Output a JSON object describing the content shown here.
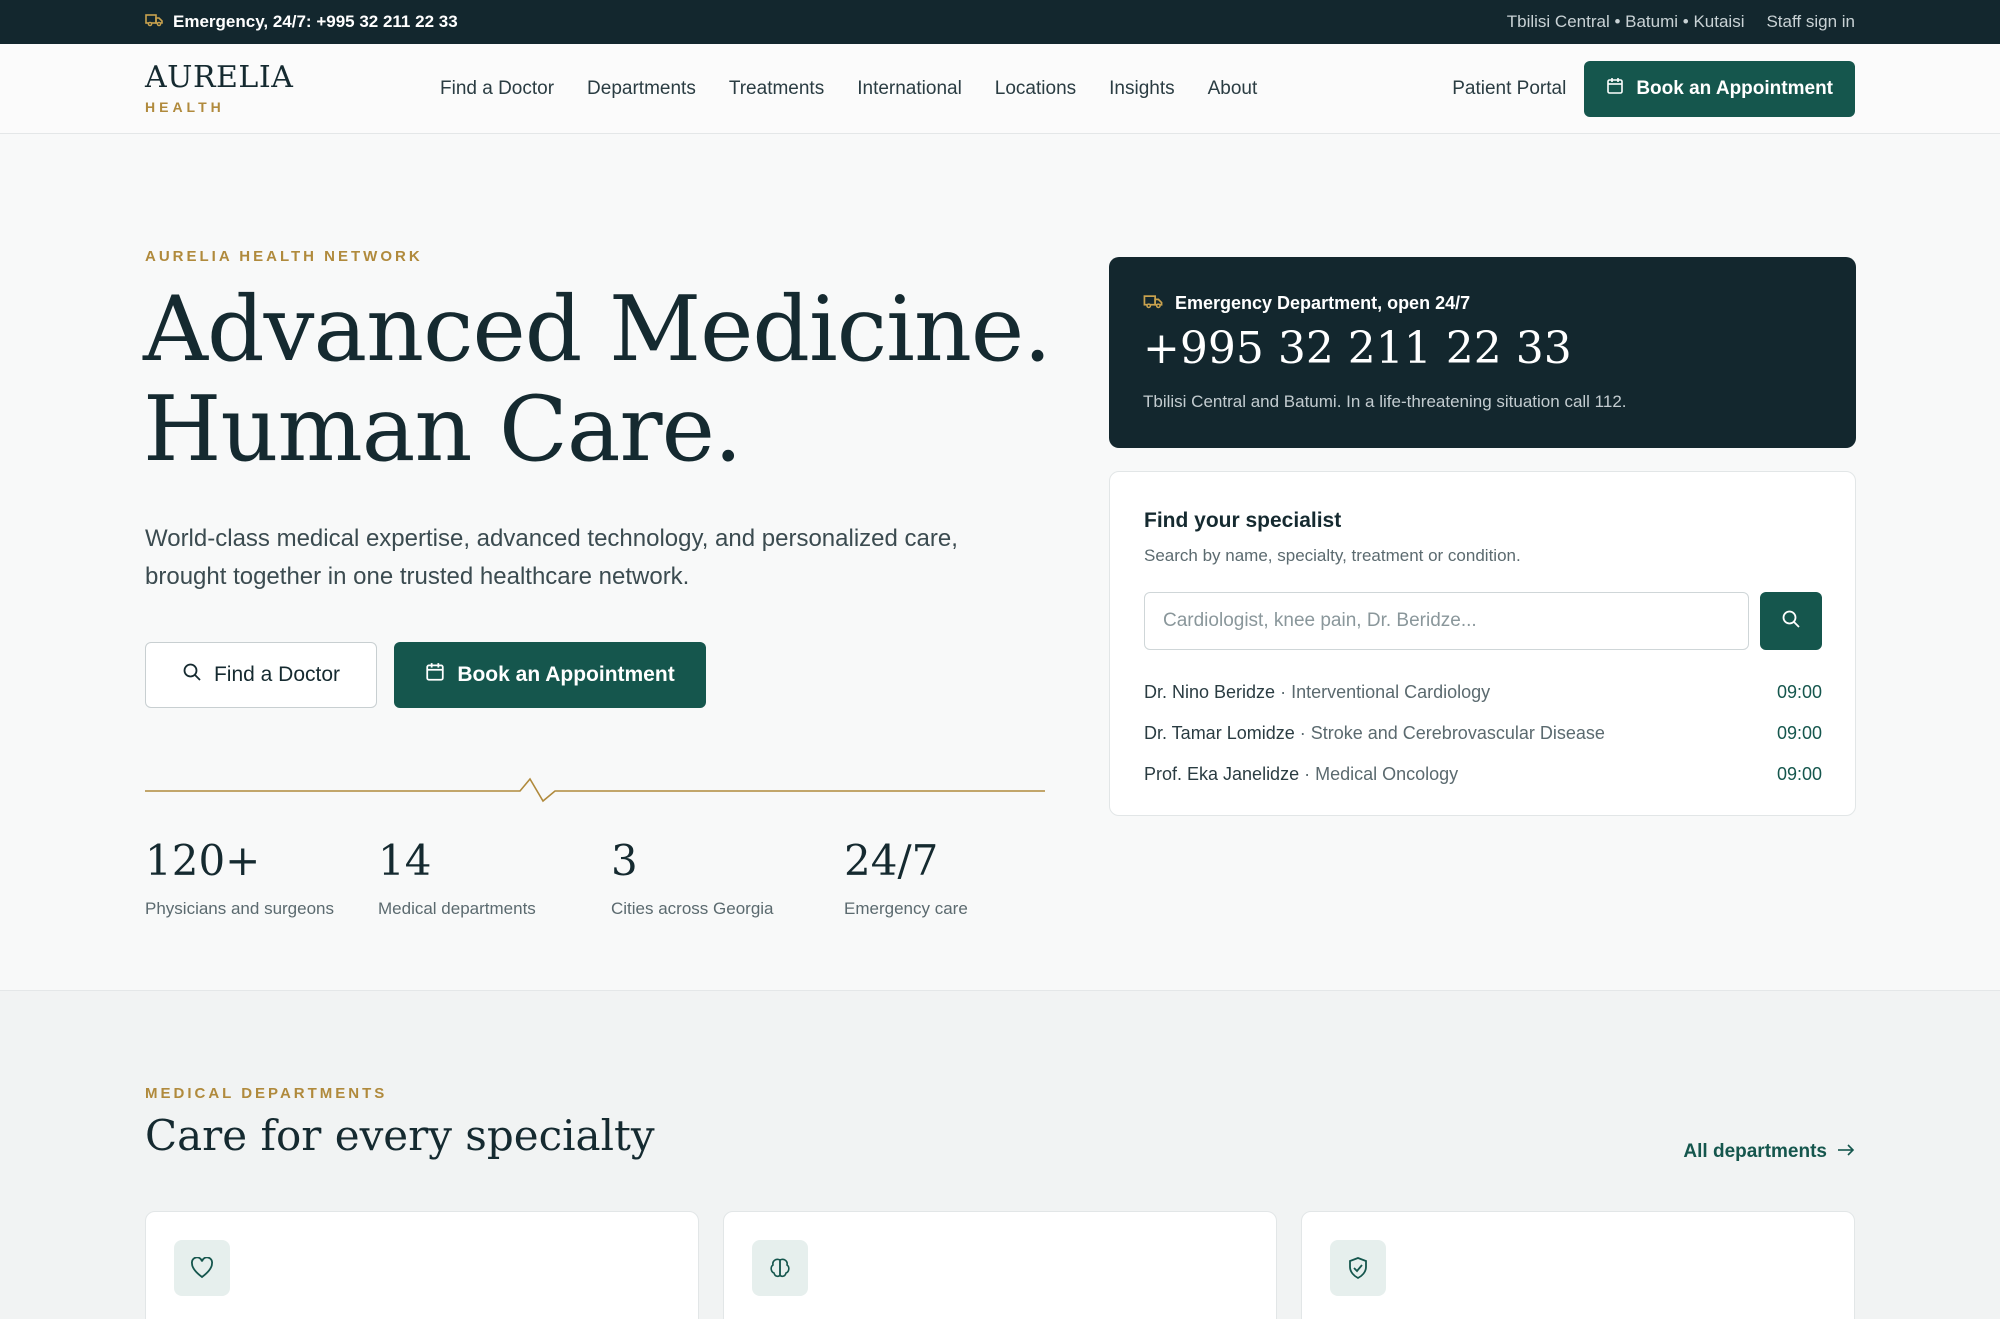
{
  "topbar": {
    "emergency": "Emergency, 24/7:  +995 32 211 22 33",
    "locations": "Tbilisi Central • Batumi • Kutaisi",
    "staff": "Staff sign in"
  },
  "nav": {
    "logo_main": "AURELIA",
    "logo_sub": "HEALTH",
    "items": [
      "Find a Doctor",
      "Departments",
      "Treatments",
      "International",
      "Locations",
      "Insights",
      "About"
    ],
    "portal": "Patient Portal",
    "book": "Book an Appointment"
  },
  "hero": {
    "eyebrow": "AURELIA HEALTH NETWORK",
    "title_line1": "Advanced Medicine.",
    "title_line2": "Human Care.",
    "subtitle": "World-class medical expertise, advanced technology, and personalized care, brought together in one trusted healthcare network.",
    "find_doctor": "Find a Doctor",
    "book": "Book an Appointment",
    "stats": [
      {
        "value": "120+",
        "label": "Physicians and surgeons"
      },
      {
        "value": "14",
        "label": "Medical departments"
      },
      {
        "value": "3",
        "label": "Cities across Georgia"
      },
      {
        "value": "24/7",
        "label": "Emergency care"
      }
    ]
  },
  "emergency_card": {
    "title": "Emergency Department, open 24/7",
    "phone": "+995 32 211 22 33",
    "desc": "Tbilisi Central and Batumi. In a life-threatening situation call 112."
  },
  "specialist": {
    "title": "Find your specialist",
    "subtitle": "Search by name, specialty, treatment or condition.",
    "placeholder": "Cardiologist, knee pain, Dr. Beridze...",
    "doctors": [
      {
        "name": "Dr. Nino Beridze",
        "specialty": "Interventional Cardiology",
        "time": "09:00"
      },
      {
        "name": "Dr. Tamar Lomidze",
        "specialty": "Stroke and Cerebrovascular Disease",
        "time": "09:00"
      },
      {
        "name": "Prof. Eka Janelidze",
        "specialty": "Medical Oncology",
        "time": "09:00"
      }
    ]
  },
  "departments": {
    "eyebrow": "MEDICAL DEPARTMENTS",
    "title": "Care for every specialty",
    "link": "All departments"
  },
  "colors": {
    "accent": "#15564d",
    "gold": "#b08a3c",
    "dark": "#13272e"
  }
}
